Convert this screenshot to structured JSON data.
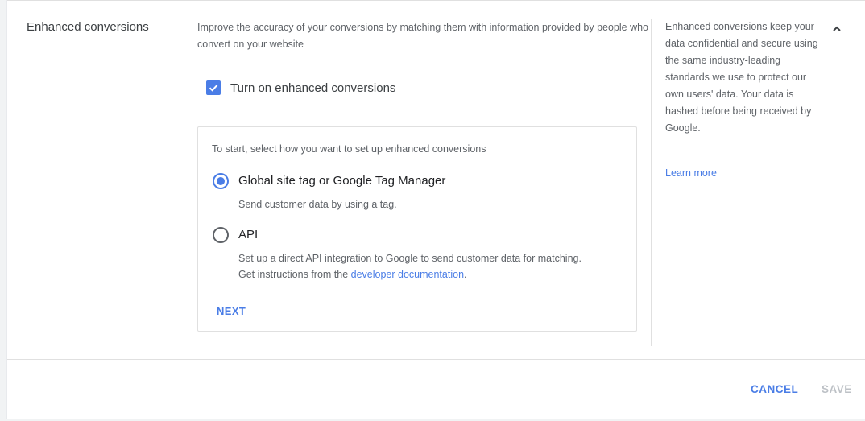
{
  "section": {
    "title": "Enhanced conversions",
    "intro": "Improve the accuracy of your conversions by matching them with information provided by people who convert on your website"
  },
  "checkbox": {
    "label": "Turn on enhanced conversions",
    "checked": true
  },
  "setup": {
    "prompt": "To start, select how you want to set up enhanced conversions",
    "options": [
      {
        "label": "Global site tag or Google Tag Manager",
        "description": "Send customer data by using a tag.",
        "selected": true
      },
      {
        "label": "API",
        "description_line1": "Set up a direct API integration to Google to send customer data for matching.",
        "description_line2_prefix": "Get instructions from the ",
        "description_link": "developer documentation",
        "description_line2_suffix": ".",
        "selected": false
      }
    ],
    "next_label": "NEXT"
  },
  "help": {
    "text": "Enhanced conversions keep your data confidential and secure using the same industry-leading standards we use to protect our own users' data. Your data is hashed before being received by Google.",
    "learn_more": "Learn more"
  },
  "footer": {
    "cancel_label": "CANCEL",
    "save_label": "SAVE"
  },
  "icons": {
    "collapse": "chevron-up-icon",
    "checkbox": "check-icon"
  },
  "colors": {
    "accent": "#4a7de6",
    "disabled": "#bdc1c6"
  }
}
